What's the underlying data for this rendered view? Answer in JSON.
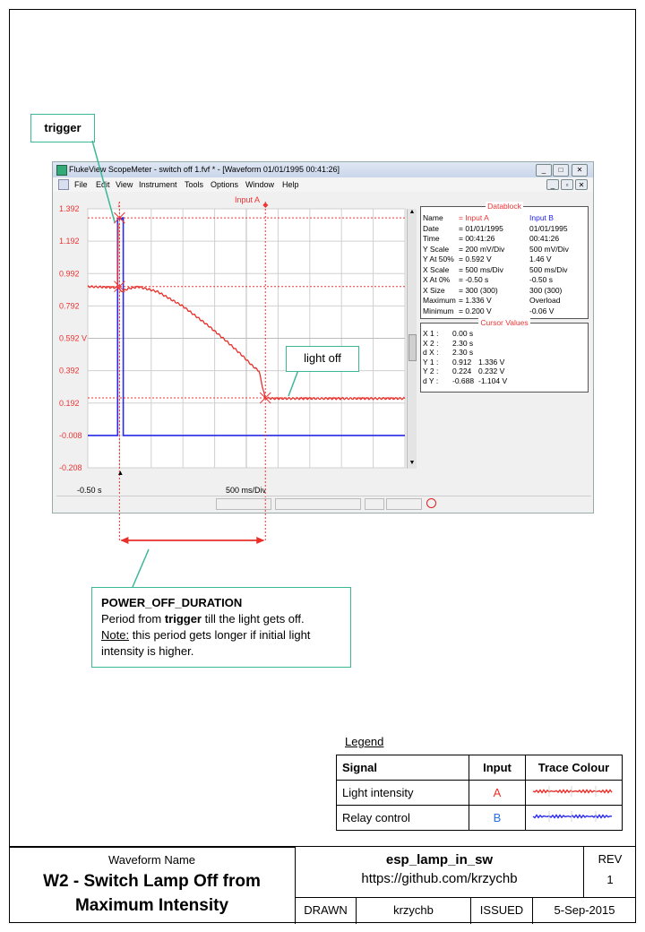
{
  "callouts": {
    "trigger": "trigger",
    "light_off": "light off",
    "power_title": "POWER_OFF_DURATION",
    "power_line1_a": "Period from ",
    "power_line1_b": "trigger",
    "power_line1_c": " till the light gets off.",
    "power_note_label": "Note:",
    "power_note_text": " this period gets longer if initial light",
    "power_line3": "intensity is higher."
  },
  "window": {
    "title": "FlukeView ScopeMeter - switch off 1.fvf * - [Waveform 01/01/1995 00:41:26]",
    "menu": [
      "File",
      "Edit",
      "View",
      "Instrument",
      "Tools",
      "Options",
      "Window",
      "Help"
    ]
  },
  "chart_data": {
    "type": "line",
    "title": "",
    "input_label": "Input A",
    "xlabel_left": "-0.50 s",
    "xlabel_center": "500 ms/Div",
    "y_ticks": [
      "1.392",
      "1.192",
      "0.992",
      "0.792",
      "0.592 V",
      "0.392",
      "0.192",
      "-0.008",
      "-0.208"
    ],
    "ylim": [
      -0.208,
      1.392
    ],
    "xlim": [
      -0.5,
      4.5
    ],
    "series": [
      {
        "name": "Input A",
        "color": "#e8302a",
        "x": [
          -0.5,
          -0.02,
          0.0,
          0.02,
          0.05,
          0.15,
          0.3,
          0.6,
          1.0,
          1.4,
          1.7,
          1.95,
          2.1,
          2.2,
          2.25,
          2.28,
          2.3,
          2.4,
          2.6,
          3.0,
          3.5,
          4.0,
          4.5
        ],
        "y": [
          0.912,
          0.905,
          0.9,
          0.88,
          0.885,
          0.9,
          0.91,
          0.88,
          0.79,
          0.67,
          0.57,
          0.48,
          0.42,
          0.39,
          0.3,
          0.25,
          0.224,
          0.22,
          0.22,
          0.22,
          0.22,
          0.22,
          0.22
        ]
      },
      {
        "name": "Input B",
        "color": "#2a2ae8",
        "x": [
          -0.5,
          -0.04,
          -0.03,
          -0.03,
          0.05,
          0.05,
          0.06,
          0.06,
          4.5
        ],
        "y": [
          -0.008,
          -0.008,
          -0.008,
          1.33,
          1.33,
          1.336,
          1.336,
          -0.008,
          -0.008
        ]
      }
    ],
    "cursors": {
      "x1": 0.0,
      "x2": 2.3,
      "y1": 0.912,
      "y2": 0.224
    }
  },
  "datablock": {
    "title": "Datablock",
    "rows": [
      [
        "Name",
        "= Input A",
        "Input B"
      ],
      [
        "Date",
        "= 01/01/1995",
        "01/01/1995"
      ],
      [
        "Time",
        "= 00:41:26",
        "00:41:26"
      ],
      [
        "Y Scale",
        "= 200      mV/Div",
        "500      mV/Div"
      ],
      [
        "Y At 50%",
        "=     0.592 V",
        "1.46 V"
      ],
      [
        "X Scale",
        "= 500      ms/Div",
        "500      ms/Div"
      ],
      [
        "X At 0%",
        "=     -0.50  s",
        "-0.50 s"
      ],
      [
        "X Size",
        "= 300 (300)",
        "300 (300)"
      ],
      [
        "Maximum",
        "=     1.336 V",
        "Overload"
      ],
      [
        "Minimum",
        "=     0.200 V",
        "-0.06 V"
      ]
    ]
  },
  "cursor_values": {
    "title": "Cursor Values",
    "rows": [
      [
        "X 1 :",
        "0.00 s",
        ""
      ],
      [
        "X 2 :",
        "2.30 s",
        ""
      ],
      [
        "d X :",
        "2.30 s",
        ""
      ],
      [
        "Y 1 :",
        "0.912",
        "1.336 V"
      ],
      [
        "Y 2 :",
        "0.224",
        "0.232 V"
      ],
      [
        "d Y :",
        "-0.688",
        "-1.104 V"
      ]
    ]
  },
  "legend": {
    "heading": "Legend",
    "headers": [
      "Signal",
      "Input",
      "Trace Colour"
    ],
    "rows": [
      {
        "signal": "Light intensity",
        "input": "A",
        "input_color": "#e8302a",
        "trace_color": "#e8302a"
      },
      {
        "signal": "Relay control",
        "input": "B",
        "input_color": "#2a6ee8",
        "trace_color": "#2a2ae8"
      }
    ]
  },
  "title_block": {
    "waveform_name_label": "Waveform Name",
    "waveform_name_line1": "W2 - Switch Lamp Off from",
    "waveform_name_line2": "Maximum Intensity",
    "project": "esp_lamp_in_sw",
    "url": "https://github.com/krzychb",
    "rev_label": "REV",
    "rev": "1",
    "drawn_label": "DRAWN",
    "drawn": "krzychb",
    "issued_label": "ISSUED",
    "issued": "5-Sep-2015"
  }
}
